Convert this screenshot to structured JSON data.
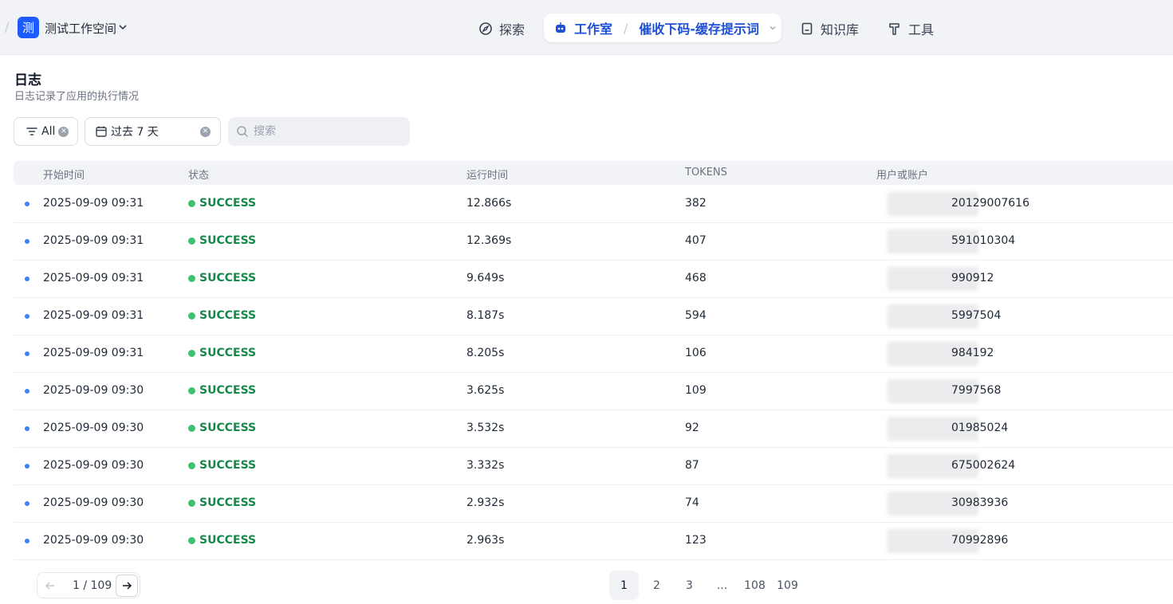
{
  "header": {
    "workspace_initial": "测",
    "workspace_name": "测试工作空间",
    "nav": {
      "explore": "探索",
      "studio": "工作室",
      "app_name": "催收下码-缓存提示词",
      "knowledge": "知识库",
      "tools": "工具"
    }
  },
  "page": {
    "title": "日志",
    "subtitle": "日志记录了应用的执行情况"
  },
  "filters": {
    "status": "All",
    "date_range": "过去 7 天",
    "search_placeholder": "搜索"
  },
  "table": {
    "columns": [
      "开始时间",
      "状态",
      "运行时间",
      "TOKENS",
      "用户或账户"
    ],
    "rows": [
      {
        "start": "2025-09-09 09:31",
        "status": "SUCCESS",
        "runtime": "12.866s",
        "tokens": "382",
        "user": "20129007616"
      },
      {
        "start": "2025-09-09 09:31",
        "status": "SUCCESS",
        "runtime": "12.369s",
        "tokens": "407",
        "user": "591010304"
      },
      {
        "start": "2025-09-09 09:31",
        "status": "SUCCESS",
        "runtime": "9.649s",
        "tokens": "468",
        "user": "990912"
      },
      {
        "start": "2025-09-09 09:31",
        "status": "SUCCESS",
        "runtime": "8.187s",
        "tokens": "594",
        "user": "5997504"
      },
      {
        "start": "2025-09-09 09:31",
        "status": "SUCCESS",
        "runtime": "8.205s",
        "tokens": "106",
        "user": "984192"
      },
      {
        "start": "2025-09-09 09:30",
        "status": "SUCCESS",
        "runtime": "3.625s",
        "tokens": "109",
        "user": "7997568"
      },
      {
        "start": "2025-09-09 09:30",
        "status": "SUCCESS",
        "runtime": "3.532s",
        "tokens": "92",
        "user": "01985024"
      },
      {
        "start": "2025-09-09 09:30",
        "status": "SUCCESS",
        "runtime": "3.332s",
        "tokens": "87",
        "user": "675002624"
      },
      {
        "start": "2025-09-09 09:30",
        "status": "SUCCESS",
        "runtime": "2.932s",
        "tokens": "74",
        "user": "30983936"
      },
      {
        "start": "2025-09-09 09:30",
        "status": "SUCCESS",
        "runtime": "2.963s",
        "tokens": "123",
        "user": "70992896"
      }
    ]
  },
  "pagination": {
    "current": "1",
    "indicator": "1 / 109",
    "pages": [
      "1",
      "2",
      "3",
      "...",
      "108",
      "109"
    ]
  },
  "colors": {
    "accent": "#1d4fd8",
    "success": "#16884a",
    "dot": "#3b82f6"
  }
}
